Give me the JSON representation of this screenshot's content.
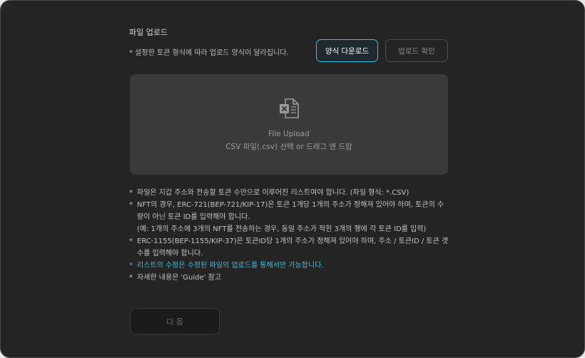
{
  "upload": {
    "title": "파일 업로드",
    "notice": "* 설정한 토큰 형식에 따라 업로드 양식이 달라집니다.",
    "template_download_label": "양식 다운로드",
    "confirm_label": "업로드 확인"
  },
  "dropzone": {
    "icon": "excel-file-icon",
    "title": "File Upload",
    "subtitle": "CSV 파일(.csv) 선택 or 드래그 앤 드랍"
  },
  "notes": {
    "bullet": "*",
    "items": [
      "파일은 지갑 주소와 전송할 토큰 수만으로 이루어진 리스트여야 합니다. (파일 형식: *.CSV)",
      "NFT의 경우, ERC-721(BEP-721/KIP-17)은 토큰 1개당 1개의 주소가 정해져 있어야 하며, 토큰의 수량이 아닌 토큰 ID를 입력해야 합니다.",
      "(예: 1개의 주소에 3개의 NFT를 전송하는 경우, 동일 주소가 적힌 3개의 행에 각 토큰 ID를 입력)",
      "ERC-1155(BEP-1155/KIP-37)은 토큰ID당 1개의 주소가 정해져 있어야 하며, 주소 / 토큰ID / 토큰 갯수를 입력해야 합니다.",
      "리스트의 수정은 수정된 파일의 업로드를 통해서만 가능합니다.",
      "자세한 내용은 'Guide' 참고"
    ]
  },
  "footer": {
    "next_label": "다 음"
  },
  "colors": {
    "accent": "#35c1e6",
    "panel_bg": "#242424",
    "dropzone_bg": "#3a3a3a"
  }
}
